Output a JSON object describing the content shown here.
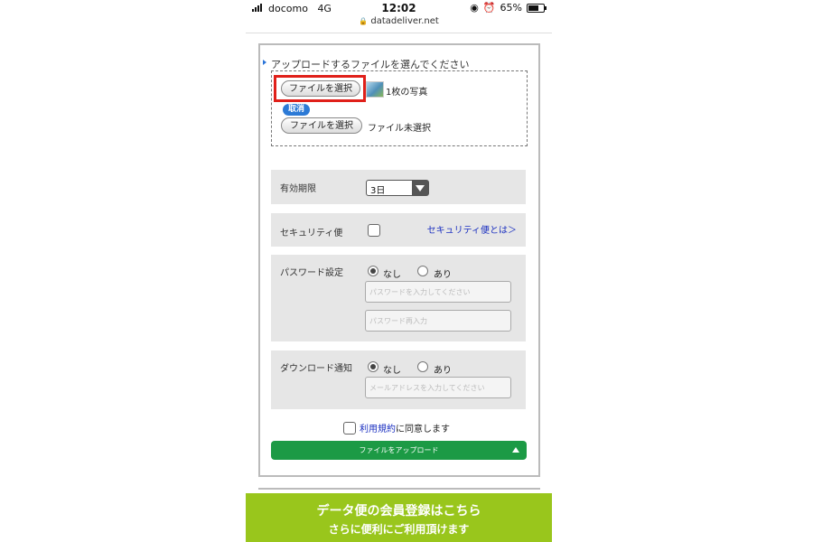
{
  "status_bar": {
    "carrier": "docomo",
    "network": "4G",
    "time": "12:02",
    "url": "datadeliver.net",
    "battery": "65%"
  },
  "upload": {
    "label": "アップロードするファイルを選んでください",
    "choose_button": "ファイルを選択",
    "selected_text": "1枚の写真",
    "cancel_label": "取消",
    "choose_button_2": "ファイルを選択",
    "no_file_text": "ファイル未選択"
  },
  "expiry": {
    "label": "有効期限",
    "value": "3日"
  },
  "security": {
    "label": "セキュリティ便",
    "link": "セキュリティ便とは＞",
    "checked": false
  },
  "password": {
    "label": "パスワード設定",
    "option_none": "なし",
    "option_yes": "あり",
    "selected": "なし",
    "placeholder": "パスワードを入力してください",
    "placeholder_confirm": "パスワード再入力"
  },
  "notify": {
    "label": "ダウンロード通知",
    "option_none": "なし",
    "option_yes": "あり",
    "selected": "なし",
    "placeholder": "メールアドレスを入力してください"
  },
  "agree": {
    "link": "利用規約",
    "text": "に同意します",
    "checked": false
  },
  "submit_label": "ファイルをアップロード",
  "banner": {
    "line1": "データ便の会員登録はこちら",
    "line2": "さらに便利にご利用頂けます"
  },
  "colors": {
    "primary_button": "#1c9a45",
    "banner": "#99c61c",
    "highlight": "#e0201a",
    "link": "#1a2fc0"
  }
}
